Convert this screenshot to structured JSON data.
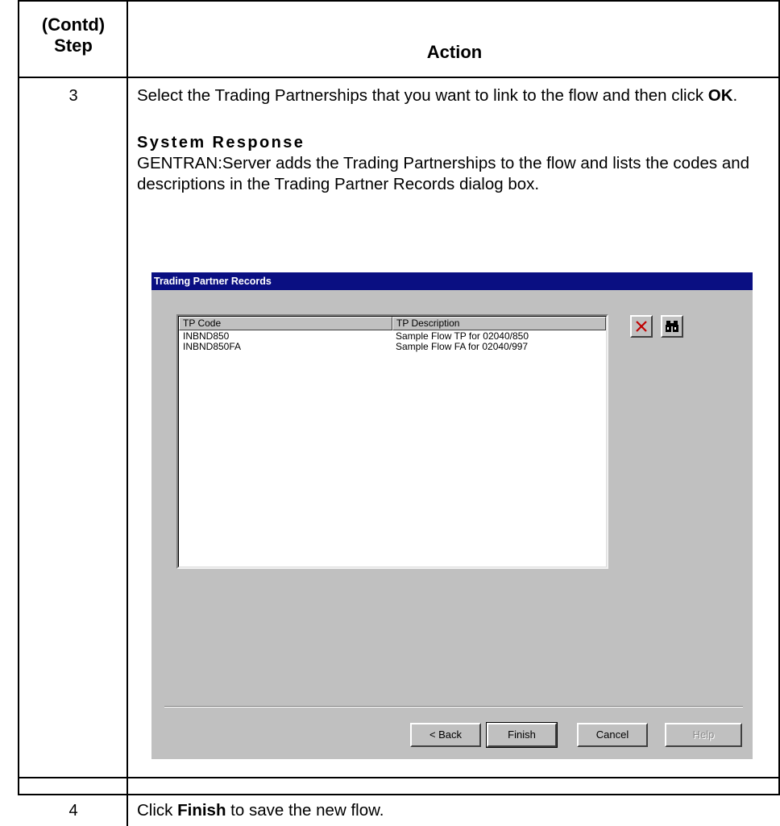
{
  "table": {
    "header_step": "(Contd)\nStep",
    "header_action": "Action"
  },
  "step3": {
    "number": "3",
    "instruction_pre": "Select the Trading Partnerships that you want to link to the flow and then click ",
    "instruction_bold": "OK",
    "instruction_post": ".",
    "response_heading": "System Response",
    "response_text": "GENTRAN:Server adds the Trading Partnerships to the flow and lists the codes and descriptions in the Trading Partner Records dialog box."
  },
  "dialog": {
    "title": "Trading Partner Records",
    "columns": [
      "TP Code",
      "TP Description"
    ],
    "rows": [
      {
        "code": "INBND850",
        "description": "Sample Flow TP for 02040/850"
      },
      {
        "code": "INBND850FA",
        "description": "Sample Flow FA for 02040/997"
      }
    ],
    "delete_icon": "delete-x-icon",
    "find_icon": "binoculars-icon",
    "buttons": {
      "back": "< Back",
      "finish": "Finish",
      "cancel": "Cancel",
      "help": "Help"
    }
  },
  "step4": {
    "number": "4",
    "instruction_pre": "Click ",
    "instruction_bold": "Finish",
    "instruction_post": " to save the new flow."
  }
}
